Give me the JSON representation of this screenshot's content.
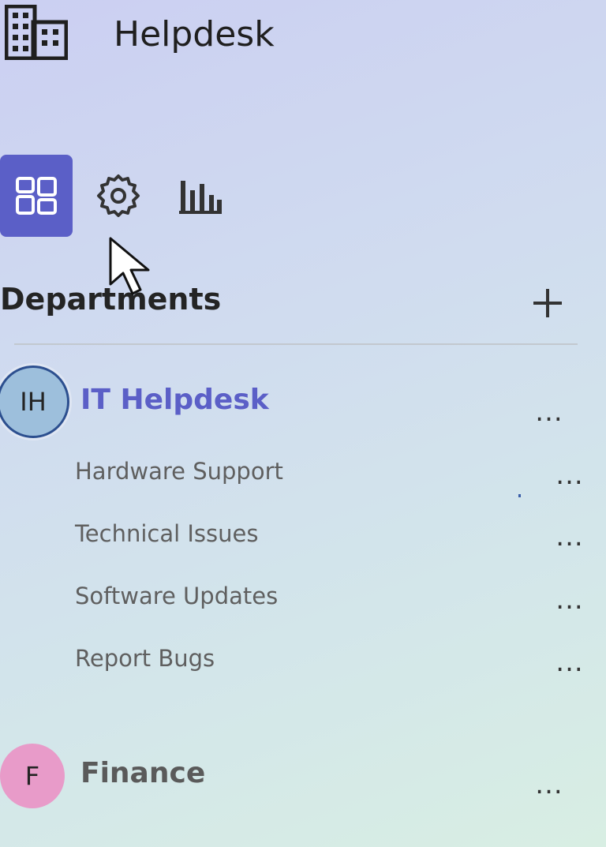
{
  "app": {
    "title": "Helpdesk",
    "logo_icon": "building-icon"
  },
  "toolbar": {
    "items": [
      {
        "name": "overview",
        "icon": "grid-dashboard-icon",
        "active": true
      },
      {
        "name": "settings",
        "icon": "gear-icon",
        "active": false
      },
      {
        "name": "analytics",
        "icon": "bar-chart-icon",
        "active": false
      }
    ]
  },
  "section": {
    "title": "Departments",
    "add_label": "+"
  },
  "teams": [
    {
      "initials": "IH",
      "name": "IT Helpdesk",
      "more": "...",
      "avatar_color": "#9dbfdc",
      "selected": true,
      "channels": [
        {
          "name": "Hardware Support",
          "more": "..."
        },
        {
          "name": "Technical Issues",
          "more": "..."
        },
        {
          "name": "Software Updates",
          "more": "..."
        },
        {
          "name": "Report Bugs",
          "more": "..."
        }
      ]
    },
    {
      "initials": "F",
      "name": "Finance",
      "more": "...",
      "avatar_color": "#e89bc9",
      "selected": false,
      "channels": []
    }
  ],
  "colors": {
    "accent": "#5b5fc7",
    "text_primary": "#242424",
    "text_secondary": "#5f5f5f"
  }
}
